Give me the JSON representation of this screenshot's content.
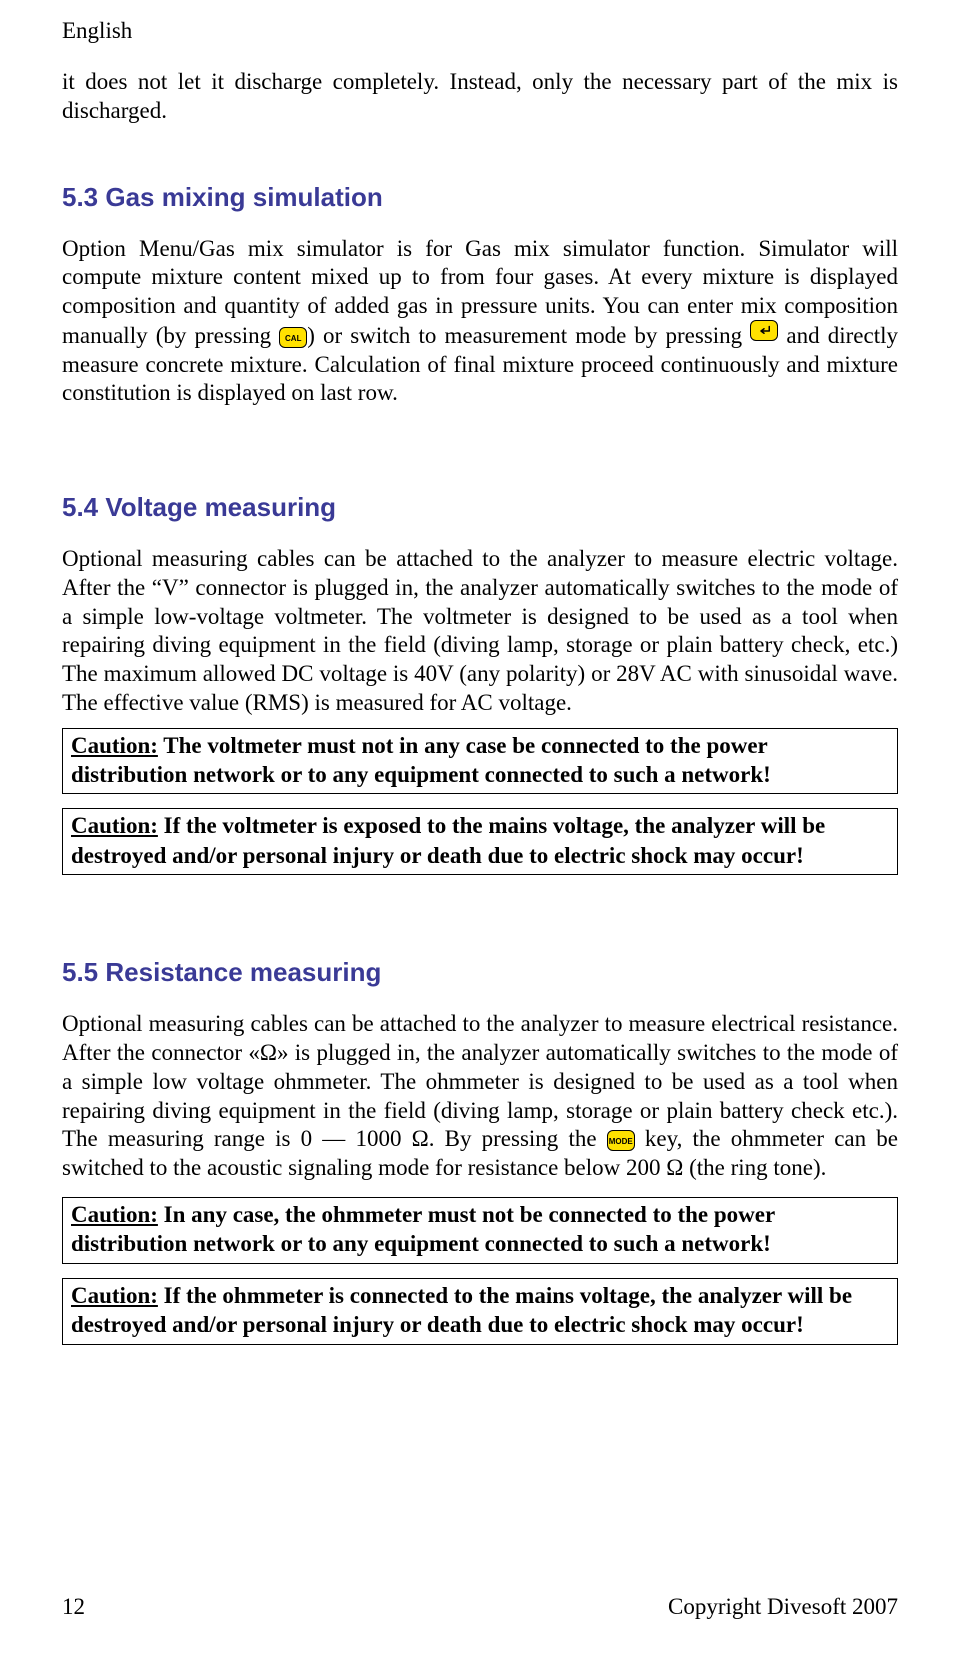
{
  "header": "English",
  "sec53": {
    "intro": "it does not let it discharge completely. Instead, only the necessary part of the mix is discharged.",
    "title": "5.3 Gas mixing simulation",
    "p1": "Option Menu/Gas mix simulator is for Gas mix simulator function. Simulator will compute mixture content mixed up to from four gases. At every mixture is displayed composition and quantity of added gas in pressure units. You can enter mix composition manually (by pressing ",
    "p2": ") or switch to measurement mode by pressing ",
    "p3": " and directly measure concrete mixture. Calculation of final mixture proceed continuously and mixture constitution is displayed on last row.",
    "key1": "CAL"
  },
  "sec54": {
    "title": "5.4 Voltage measuring",
    "body": "Optional measuring cables can be attached to the analyzer to measure electric voltage. After the “V” connector is plugged in, the analyzer automatically switches to the mode of a simple low-voltage voltmeter. The voltmeter is designed to be used as a tool when repairing diving equipment in the field (diving lamp, storage or plain battery check, etc.) The maximum allowed DC voltage is 40V (any polarity) or 28V AC with sinusoidal wave. The effective value (RMS) is measured for AC voltage.",
    "caution1_lead": "Caution:",
    "caution1_rest": " The voltmeter must not in any case be connected to the power distribution network or to any equipment connected to such a network!",
    "caution2_lead": "Caution:",
    "caution2_rest": " If the voltmeter is exposed to the mains voltage, the analyzer will be destroyed and/or personal injury or death due to electric shock may occur!"
  },
  "sec55": {
    "title": "5.5 Resistance measuring",
    "p1": "Optional measuring cables can be attached to the analyzer to measure electrical resistance. After the connector «Ω» is plugged in, the analyzer automatically switches to the mode of a simple low voltage ohmmeter. The ohmmeter is designed to be used as a tool when repairing diving equipment in the field (diving lamp, storage or plain battery check etc.). The measuring range is 0 — 1000 Ω. By pressing the ",
    "p2": " key, the ohmmeter can be switched to the acoustic signaling mode for resistance below 200 Ω (the ring tone).",
    "key": "MODE",
    "caution1_lead": "Caution:",
    "caution1_rest": " In any case, the ohmmeter must not be connected to the power distribution network or to any equipment connected to such a network!",
    "caution2_lead": "Caution:",
    "caution2_rest": " If the ohmmeter is connected to the mains voltage, the analyzer will be destroyed and/or personal injury or death due to electric shock may occur!"
  },
  "footer": {
    "page": "12",
    "copyright": "Copyright Divesoft 2007"
  }
}
